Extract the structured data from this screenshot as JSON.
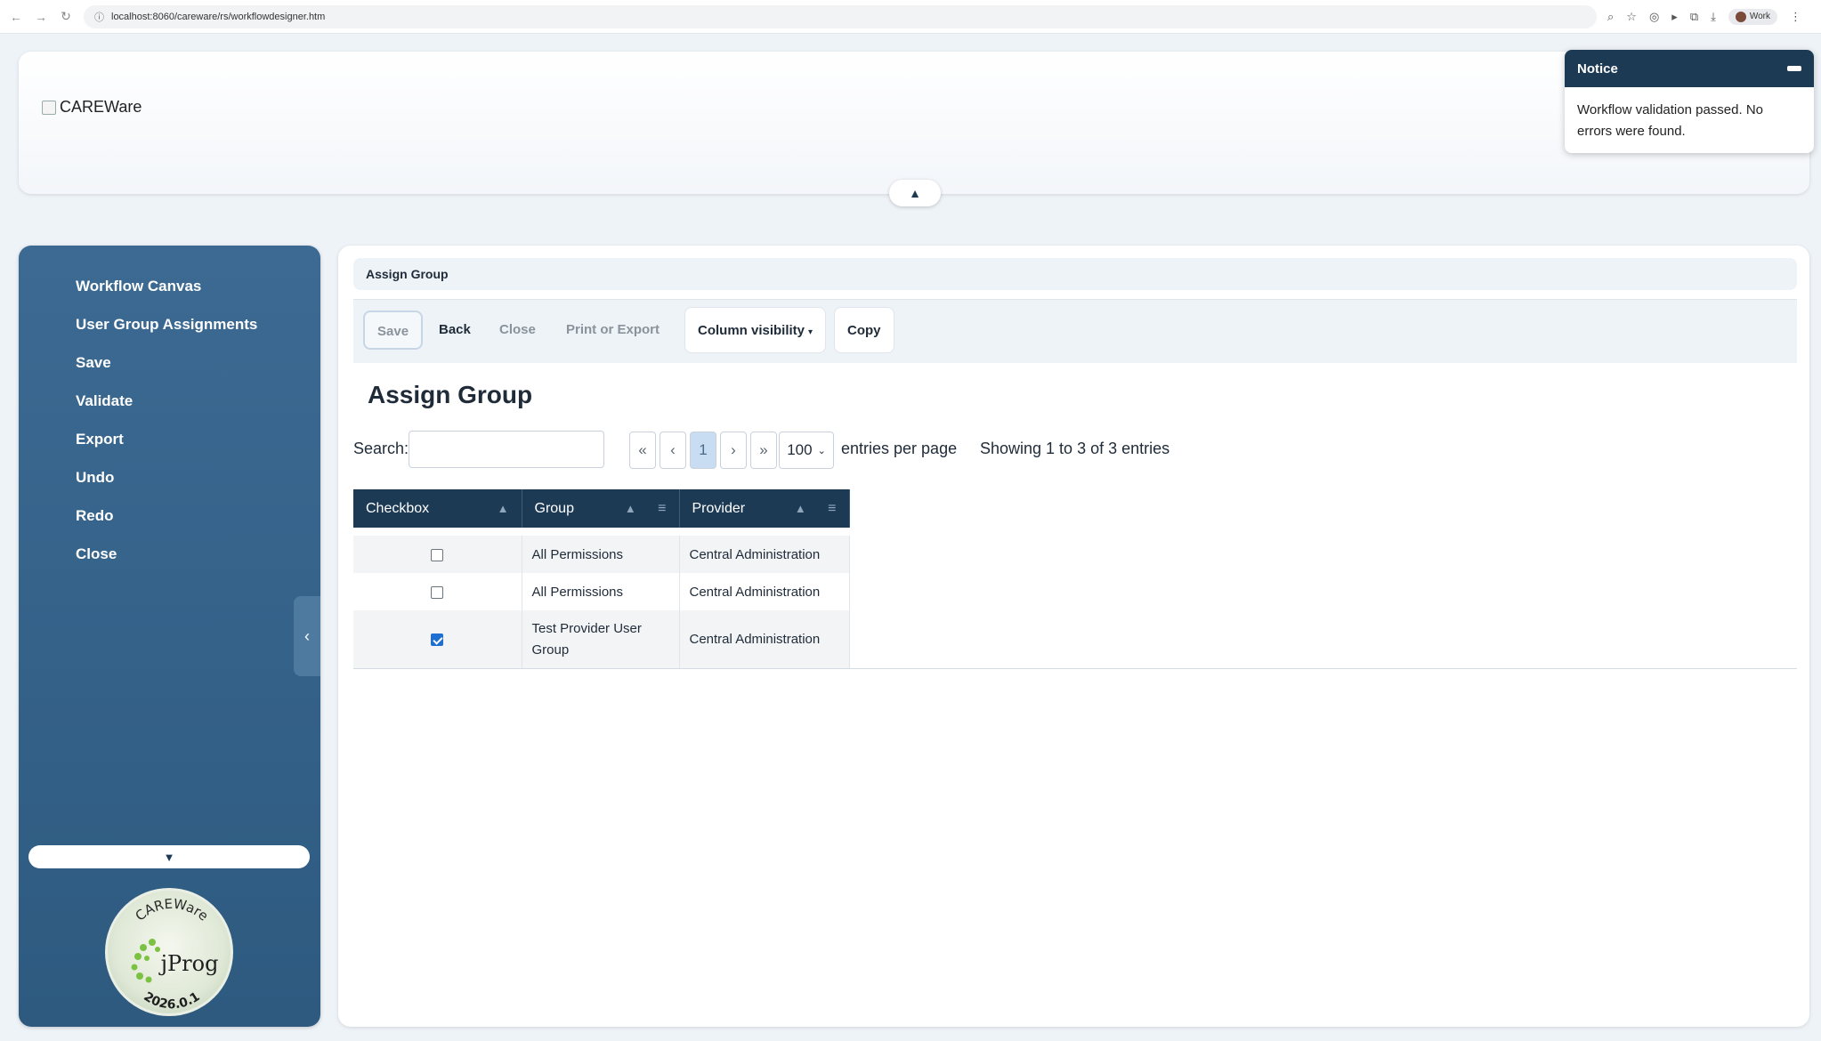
{
  "browser": {
    "url": "localhost:8060/careware/rs/workflowdesigner.htm",
    "profile": "Work"
  },
  "header": {
    "logo_alt": "CAREWare"
  },
  "notice": {
    "title": "Notice",
    "message": "Workflow validation passed. No errors were found."
  },
  "sidebar": {
    "items": [
      {
        "label": "Workflow Canvas"
      },
      {
        "label": "User Group Assignments"
      },
      {
        "label": "Save"
      },
      {
        "label": "Validate"
      },
      {
        "label": "Export"
      },
      {
        "label": "Undo"
      },
      {
        "label": "Redo"
      },
      {
        "label": "Close"
      }
    ],
    "badge": {
      "top_text": "CAREWare",
      "brand": "jProg",
      "version": "2026.0.1"
    }
  },
  "main": {
    "breadcrumb": "Assign Group",
    "toolbar": {
      "save": "Save",
      "back": "Back",
      "close": "Close",
      "print_export": "Print or Export",
      "column_visibility": "Column visibility",
      "copy": "Copy"
    },
    "title": "Assign Group",
    "search_label": "Search:",
    "search_value": "",
    "pager": {
      "first": "«",
      "prev": "‹",
      "current": "1",
      "next": "›",
      "last": "»"
    },
    "per_page_value": "100",
    "per_page_label": "entries per page",
    "showing": "Showing 1 to 3 of 3 entries",
    "table": {
      "columns": [
        "Checkbox",
        "Group",
        "Provider"
      ],
      "rows": [
        {
          "checked": false,
          "group": "All Permissions",
          "provider": "Central Administration"
        },
        {
          "checked": false,
          "group": "All Permissions",
          "provider": "Central Administration"
        },
        {
          "checked": true,
          "group": "Test Provider User Group",
          "provider": "Central Administration"
        }
      ]
    }
  },
  "colors": {
    "navy": "#1d3a55",
    "sidebar": "#3c6a92",
    "checkbox_on": "#1f6fd1"
  }
}
